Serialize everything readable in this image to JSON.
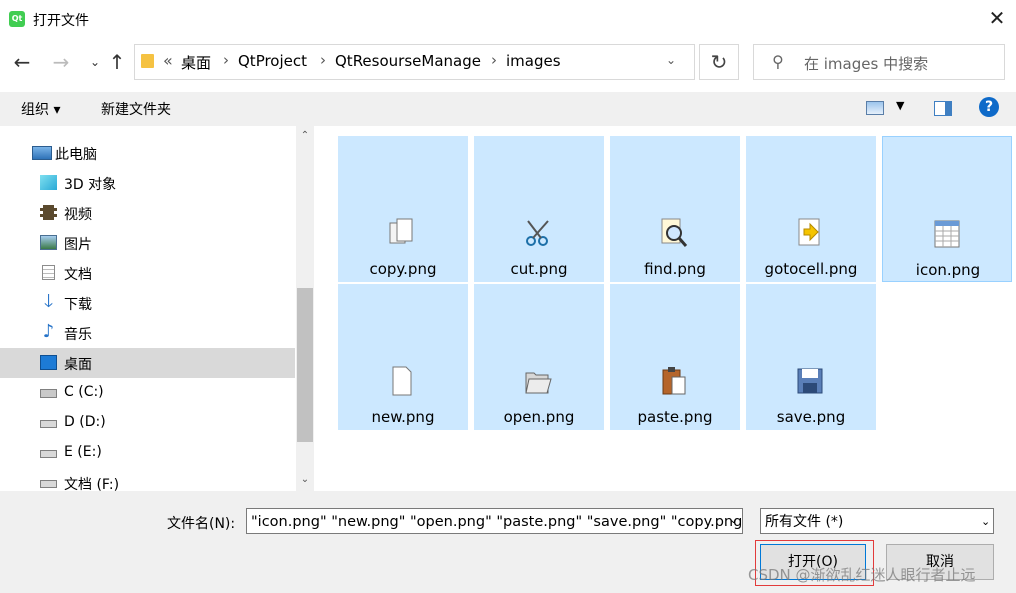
{
  "window": {
    "title": "打开文件",
    "app_icon_text": "Qt"
  },
  "address": {
    "chevrons": "«",
    "breadcrumbs": [
      "桌面",
      "QtProject",
      "QtResourseManage",
      "images"
    ],
    "separator": "›"
  },
  "search": {
    "placeholder": "在 images 中搜索"
  },
  "toolbar": {
    "organize": "组织 ▾",
    "new_folder": "新建文件夹",
    "help": "?"
  },
  "nav": {
    "items": [
      {
        "label": "此电脑",
        "icon": "computer-icon"
      },
      {
        "label": "3D 对象",
        "icon": "cube-3d-icon"
      },
      {
        "label": "视频",
        "icon": "video-icon"
      },
      {
        "label": "图片",
        "icon": "pictures-icon"
      },
      {
        "label": "文档",
        "icon": "document-icon"
      },
      {
        "label": "下载",
        "icon": "download-icon"
      },
      {
        "label": "音乐",
        "icon": "music-icon"
      },
      {
        "label": "桌面",
        "icon": "desktop-icon",
        "selected": true
      },
      {
        "label": "C (C:)",
        "icon": "drive-c-icon"
      },
      {
        "label": "D (D:)",
        "icon": "drive-icon"
      },
      {
        "label": "E (E:)",
        "icon": "drive-icon"
      },
      {
        "label": "文档 (F:)",
        "icon": "drive-icon"
      }
    ]
  },
  "files": [
    {
      "name": "copy.png",
      "icon": "copy-icon"
    },
    {
      "name": "cut.png",
      "icon": "scissors-icon"
    },
    {
      "name": "find.png",
      "icon": "magnifier-icon"
    },
    {
      "name": "gotocell.png",
      "icon": "goto-arrow-icon"
    },
    {
      "name": "icon.png",
      "icon": "spreadsheet-icon",
      "focused": true
    },
    {
      "name": "new.png",
      "icon": "new-file-icon"
    },
    {
      "name": "open.png",
      "icon": "open-folder-icon"
    },
    {
      "name": "paste.png",
      "icon": "clipboard-icon"
    },
    {
      "name": "save.png",
      "icon": "floppy-icon"
    }
  ],
  "bottom": {
    "filename_label": "文件名(N):",
    "filename_value": "\"icon.png\" \"new.png\" \"open.png\" \"paste.png\" \"save.png\" \"copy.png\" \"cut.png\"",
    "filter_value": "所有文件 (*)",
    "open_label": "打开(O)",
    "cancel_label": "取消"
  },
  "watermark": "CSDN @渐欲乱红迷人眼行者止远",
  "colors": {
    "selection": "#cce8ff",
    "accent": "#0078d7",
    "nav_selected": "#d9d9d9"
  }
}
